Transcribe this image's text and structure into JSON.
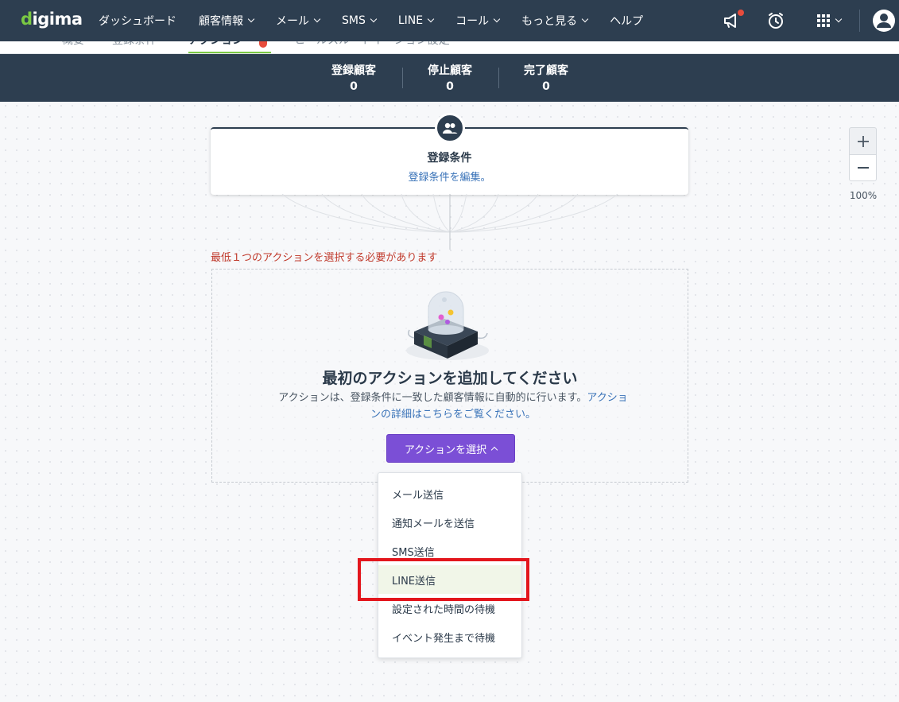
{
  "app": {
    "logo": "digima"
  },
  "nav": {
    "items": [
      {
        "label": "ダッシュボード",
        "dropdown": false
      },
      {
        "label": "顧客情報",
        "dropdown": true
      },
      {
        "label": "メール",
        "dropdown": true
      },
      {
        "label": "SMS",
        "dropdown": true
      },
      {
        "label": "LINE",
        "dropdown": true
      },
      {
        "label": "コール",
        "dropdown": true
      },
      {
        "label": "もっと見る",
        "dropdown": true
      },
      {
        "label": "ヘルプ",
        "dropdown": false
      }
    ],
    "icons": [
      "megaphone-icon",
      "alarm-clock-icon",
      "apps-grid-icon",
      "user-avatar-icon"
    ]
  },
  "tabs": {
    "items": [
      {
        "label": "概要"
      },
      {
        "label": "登録条件"
      },
      {
        "label": "アクション",
        "active": true
      },
      {
        "label": "ヒールスルートイーション設定"
      }
    ]
  },
  "stats": [
    {
      "label": "登録顧客",
      "value": "0"
    },
    {
      "label": "停止顧客",
      "value": "0"
    },
    {
      "label": "完了顧客",
      "value": "0"
    }
  ],
  "condition": {
    "title": "登録条件",
    "edit_link": "登録条件を編集。"
  },
  "error": "最低１つのアクションを選択する必要があります",
  "action": {
    "title": "最初のアクションを追加してください",
    "desc": "アクションは、登録条件に一致した顧客情報に自動的に行います。",
    "desc_link": "アクションの詳細はこちらをご覧ください。",
    "select_button": "アクションを選択"
  },
  "dropdown": {
    "items": [
      {
        "label": "メール送信"
      },
      {
        "label": "通知メールを送信"
      },
      {
        "label": "SMS送信"
      },
      {
        "label": "LINE送信",
        "hover": true
      },
      {
        "label": "設定された時間の待機"
      },
      {
        "label": "イベント発生まで待機"
      }
    ]
  },
  "zoom": {
    "level": "100%"
  },
  "colors": {
    "nav_bg": "#2d3e50",
    "accent_green": "#7ac943",
    "primary_purple": "#7b4fd6",
    "error_red": "#c0392b",
    "highlight_red": "#e3161d",
    "link_blue": "#3a73b8"
  }
}
